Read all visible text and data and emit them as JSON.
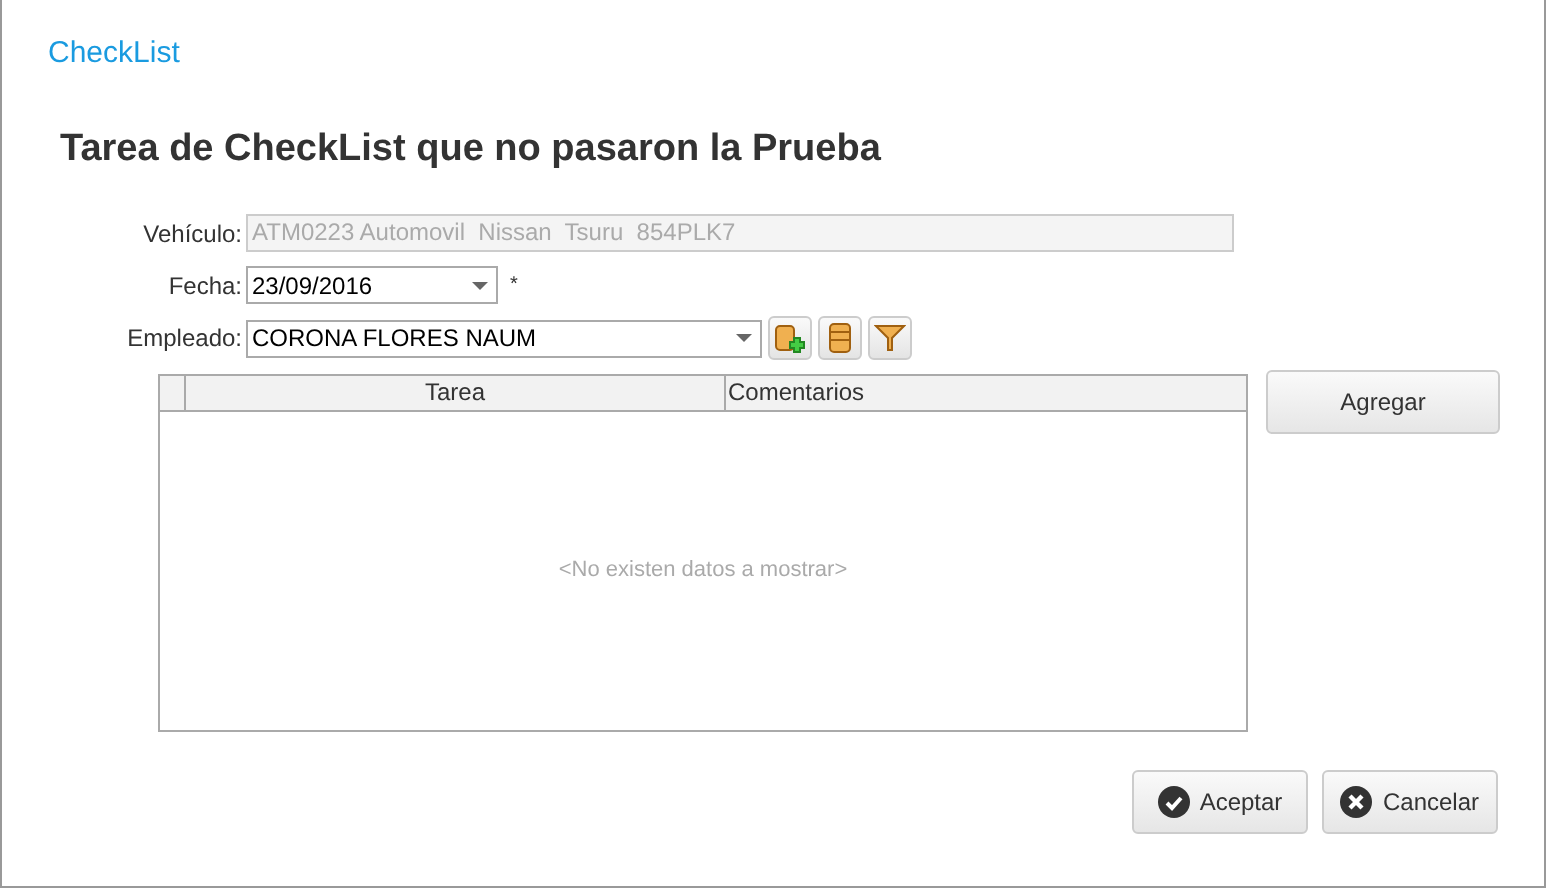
{
  "app_title": "CheckList",
  "heading": "Tarea de CheckList que no pasaron la Prueba",
  "form": {
    "vehicle": {
      "label": "Vehículo:",
      "value": "ATM0223 Automovil  Nissan  Tsuru  854PLK7",
      "disabled": true
    },
    "date": {
      "label": "Fecha:",
      "value": "23/09/2016",
      "required_mark": "*"
    },
    "employee": {
      "label": "Empleado:",
      "value": "CORONA FLORES NAUM"
    }
  },
  "table": {
    "columns": [
      "Tarea",
      "Comentarios"
    ],
    "empty_text": "<No existen datos a mostrar>"
  },
  "add_button": "Agregar",
  "buttons": [
    {
      "kind": "accept",
      "label": "Aceptar"
    },
    {
      "kind": "cancel",
      "label": "Cancelar"
    }
  ]
}
